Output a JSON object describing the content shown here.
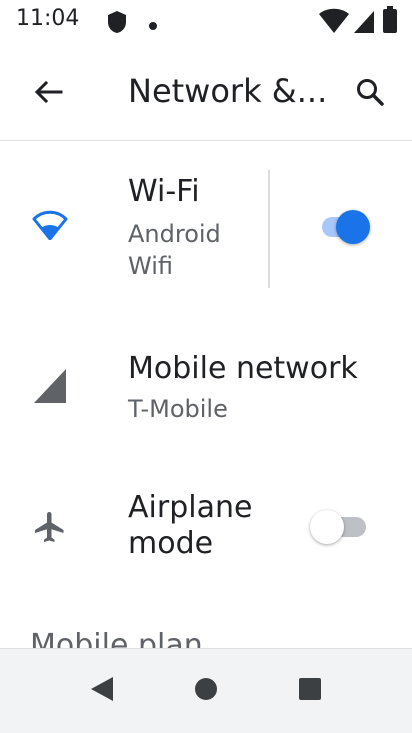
{
  "status_bar": {
    "time": "11:04"
  },
  "header": {
    "title": "Network &..."
  },
  "items": {
    "wifi": {
      "title": "Wi-Fi",
      "subtitle": "Android Wifi",
      "enabled": true
    },
    "mobile_network": {
      "title": "Mobile network",
      "subtitle": "T-Mobile"
    },
    "airplane_mode": {
      "title": "Airplane mode",
      "enabled": false
    },
    "mobile_plan": {
      "title": "Mobile plan"
    }
  },
  "colors": {
    "accent": "#1a73e8",
    "accent_track": "#a8c7fa",
    "icon": "#5f6368",
    "off_track": "#bdc1c6",
    "off_thumb": "#ffffff"
  }
}
